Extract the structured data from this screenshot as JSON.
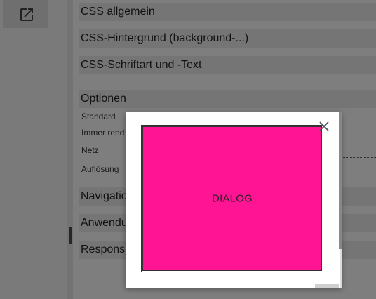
{
  "rail": {
    "items": [
      {
        "icon": "open-in-new-icon"
      }
    ]
  },
  "sections": {
    "css_general": "CSS allgemein",
    "css_background": "CSS-Hintergrund (background-...)",
    "css_font": "CSS-Schriftart und -Text",
    "options": "Optionen",
    "navigation": "Navigatio",
    "application": "Anwendu",
    "responsive": "Responsi"
  },
  "options_rows": {
    "standard": "Standard",
    "always_render": "Immer rend",
    "grid": "Netz",
    "resolution": "Auflösung"
  },
  "dialog": {
    "content_label": "DIALOG",
    "close_icon": "close-icon",
    "content_color": "#ff1493"
  },
  "colors": {
    "overlay_dim": "#7d7d7d",
    "dialog_bg": "#ffffff"
  }
}
